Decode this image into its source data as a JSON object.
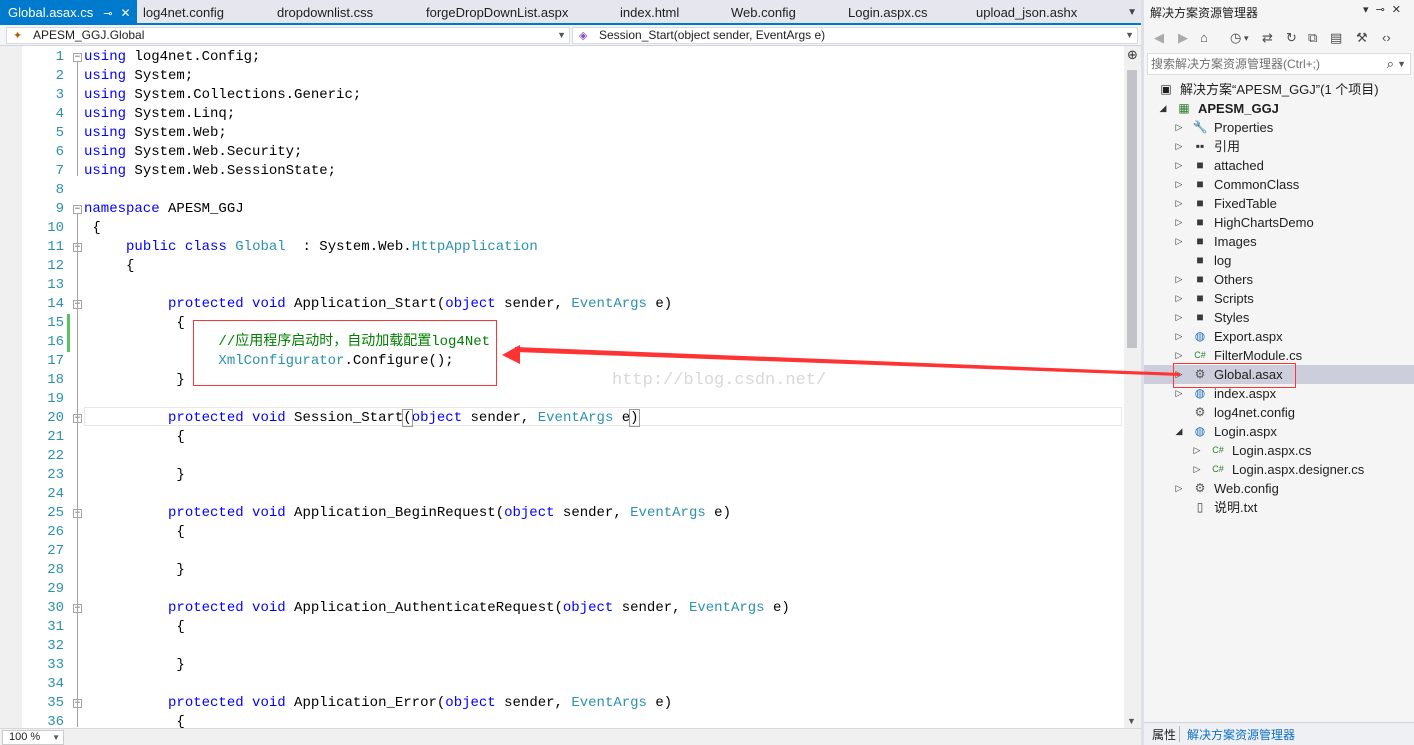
{
  "tabs": [
    {
      "label": "Global.asax.cs",
      "active": true
    },
    {
      "label": "log4net.config"
    },
    {
      "label": "dropdownlist.css"
    },
    {
      "label": "forgeDropDownList.aspx"
    },
    {
      "label": "index.html"
    },
    {
      "label": "Web.config"
    },
    {
      "label": "Login.aspx.cs"
    },
    {
      "label": "upload_json.ashx"
    }
  ],
  "nav": {
    "type_selector": "APESM_GGJ.Global",
    "member_selector": "Session_Start(object sender, EventArgs e)"
  },
  "line_numbers": [
    "1",
    "2",
    "3",
    "4",
    "5",
    "6",
    "7",
    "8",
    "9",
    "10",
    "11",
    "12",
    "13",
    "14",
    "15",
    "16",
    "17",
    "18",
    "19",
    "20",
    "21",
    "22",
    "23",
    "24",
    "25",
    "26",
    "27",
    "28",
    "29",
    "30",
    "31",
    "32",
    "33",
    "34",
    "35",
    "36"
  ],
  "code": [
    [
      [
        "kw",
        "using"
      ],
      [
        "",
        " log4net.Config;"
      ]
    ],
    [
      [
        "kw",
        "using"
      ],
      [
        "",
        " System;"
      ]
    ],
    [
      [
        "kw",
        "using"
      ],
      [
        "",
        " System.Collections.Generic;"
      ]
    ],
    [
      [
        "kw",
        "using"
      ],
      [
        "",
        " System.Linq;"
      ]
    ],
    [
      [
        "kw",
        "using"
      ],
      [
        "",
        " System.Web;"
      ]
    ],
    [
      [
        "kw",
        "using"
      ],
      [
        "",
        " System.Web.Security;"
      ]
    ],
    [
      [
        "kw",
        "using"
      ],
      [
        "",
        " System.Web.SessionState;"
      ]
    ],
    [],
    [
      [
        "kw",
        "namespace"
      ],
      [
        "",
        " APESM_GGJ"
      ]
    ],
    [
      [
        "",
        " {"
      ]
    ],
    [
      [
        "",
        "     "
      ],
      [
        "kw",
        "public"
      ],
      [
        "",
        " "
      ],
      [
        "kw",
        "class"
      ],
      [
        "",
        " "
      ],
      [
        "ty",
        "Global"
      ],
      [
        "",
        "  : System.Web."
      ],
      [
        "ty",
        "HttpApplication"
      ]
    ],
    [
      [
        "",
        "     {"
      ]
    ],
    [],
    [
      [
        "",
        "          "
      ],
      [
        "kw",
        "protected"
      ],
      [
        "",
        " "
      ],
      [
        "kw",
        "void"
      ],
      [
        "",
        " Application_Start("
      ],
      [
        "kw",
        "object"
      ],
      [
        "",
        " sender, "
      ],
      [
        "ty",
        "EventArgs"
      ],
      [
        "",
        " e)"
      ]
    ],
    [
      [
        "",
        "           {"
      ]
    ],
    [
      [
        "",
        "                "
      ],
      [
        "cm",
        "//应用程序启动时，自动加载配置log4Net"
      ]
    ],
    [
      [
        "",
        "                "
      ],
      [
        "ty",
        "XmlConfigurator"
      ],
      [
        "",
        ".Configure();"
      ]
    ],
    [
      [
        "",
        "           }"
      ]
    ],
    [],
    [
      [
        "",
        "          "
      ],
      [
        "kw",
        "protected"
      ],
      [
        "",
        " "
      ],
      [
        "kw",
        "void"
      ],
      [
        "",
        " Session_Start"
      ],
      [
        "hl",
        "("
      ],
      [
        "kw",
        "object"
      ],
      [
        "",
        " sender, "
      ],
      [
        "ty",
        "EventArgs"
      ],
      [
        "",
        " e"
      ],
      [
        "hl",
        ")"
      ]
    ],
    [
      [
        "",
        "           {"
      ]
    ],
    [],
    [
      [
        "",
        "           }"
      ]
    ],
    [],
    [
      [
        "",
        "          "
      ],
      [
        "kw",
        "protected"
      ],
      [
        "",
        " "
      ],
      [
        "kw",
        "void"
      ],
      [
        "",
        " Application_BeginRequest("
      ],
      [
        "kw",
        "object"
      ],
      [
        "",
        " sender, "
      ],
      [
        "ty",
        "EventArgs"
      ],
      [
        "",
        " e)"
      ]
    ],
    [
      [
        "",
        "           {"
      ]
    ],
    [],
    [
      [
        "",
        "           }"
      ]
    ],
    [],
    [
      [
        "",
        "          "
      ],
      [
        "kw",
        "protected"
      ],
      [
        "",
        " "
      ],
      [
        "kw",
        "void"
      ],
      [
        "",
        " Application_AuthenticateRequest("
      ],
      [
        "kw",
        "object"
      ],
      [
        "",
        " sender, "
      ],
      [
        "ty",
        "EventArgs"
      ],
      [
        "",
        " e)"
      ]
    ],
    [
      [
        "",
        "           {"
      ]
    ],
    [],
    [
      [
        "",
        "           }"
      ]
    ],
    [],
    [
      [
        "",
        "          "
      ],
      [
        "kw",
        "protected"
      ],
      [
        "",
        " "
      ],
      [
        "kw",
        "void"
      ],
      [
        "",
        " Application_Error("
      ],
      [
        "kw",
        "object"
      ],
      [
        "",
        " sender, "
      ],
      [
        "ty",
        "EventArgs"
      ],
      [
        "",
        " e)"
      ]
    ],
    [
      [
        "",
        "           {"
      ]
    ]
  ],
  "watermark": "http://blog.csdn.net/",
  "zoom": "100 %",
  "solution_explorer": {
    "title": "解决方案资源管理器",
    "search_placeholder": "搜索解决方案资源管理器(Ctrl+;)",
    "solution_label": "解决方案“APESM_GGJ”(1 个项目)",
    "project_label": "APESM_GGJ",
    "items": [
      {
        "label": "Properties",
        "icon": "wrench-icon",
        "expandable": true
      },
      {
        "label": "引用",
        "icon": "references-icon",
        "expandable": true
      },
      {
        "label": "attached",
        "icon": "folder-icon",
        "expandable": true
      },
      {
        "label": "CommonClass",
        "icon": "folder-icon",
        "expandable": true
      },
      {
        "label": "FixedTable",
        "icon": "folder-icon",
        "expandable": true
      },
      {
        "label": "HighChartsDemo",
        "icon": "folder-icon",
        "expandable": true
      },
      {
        "label": "Images",
        "icon": "folder-icon",
        "expandable": true
      },
      {
        "label": "log",
        "icon": "folder-icon",
        "expandable": false
      },
      {
        "label": "Others",
        "icon": "folder-icon",
        "expandable": true
      },
      {
        "label": "Scripts",
        "icon": "folder-icon",
        "expandable": true
      },
      {
        "label": "Styles",
        "icon": "folder-icon",
        "expandable": true
      },
      {
        "label": "Export.aspx",
        "icon": "web-page-icon",
        "expandable": true
      },
      {
        "label": "FilterModule.cs",
        "icon": "csharp-file-icon",
        "expandable": true
      },
      {
        "label": "Global.asax",
        "icon": "config-file-icon",
        "expandable": true,
        "selected": true
      },
      {
        "label": "index.aspx",
        "icon": "web-page-icon",
        "expandable": true
      },
      {
        "label": "log4net.config",
        "icon": "config-file-icon",
        "expandable": false
      },
      {
        "label": "Login.aspx",
        "icon": "web-page-icon",
        "expandable": true,
        "expanded": true
      },
      {
        "label": "Login.aspx.cs",
        "icon": "csharp-file-icon",
        "expandable": true,
        "child": true
      },
      {
        "label": "Login.aspx.designer.cs",
        "icon": "csharp-file-icon",
        "expandable": true,
        "child": true
      },
      {
        "label": "Web.config",
        "icon": "config-file-icon",
        "expandable": true
      },
      {
        "label": "说明.txt",
        "icon": "text-file-icon",
        "expandable": false
      }
    ],
    "bottom_tabs": [
      "属性",
      "解决方案资源管理器"
    ]
  },
  "colors": {
    "accent": "#007acc",
    "keyword": "#0000ff",
    "type": "#2b91af",
    "comment": "#008000",
    "annotation": "#ff3333"
  }
}
